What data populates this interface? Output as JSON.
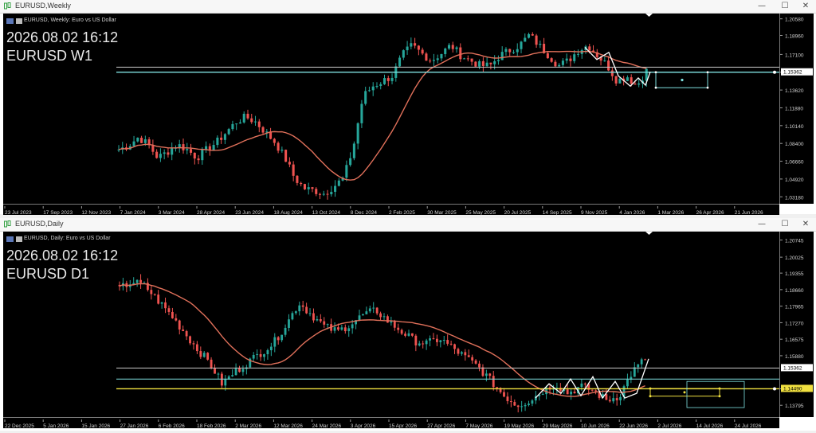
{
  "windows": [
    {
      "title": "EURUSD,Weekly",
      "symbol_label": "EURUSD, Weekly:  Euro vs US Dollar",
      "overlay_date": "2026.08.02 16:12",
      "overlay_symbol": "EURUSD W1",
      "price_tag": "1.15362",
      "buttons": {
        "minimize": "—",
        "maximize": "☐",
        "close": "✕"
      }
    },
    {
      "title": "EURUSD,Daily",
      "symbol_label": "EURUSD, Daily:  Euro vs US Dollar",
      "overlay_date": "2026.08.02 16:12",
      "overlay_symbol": "EURUSD D1",
      "price_tag": "1.15362",
      "price_tag_2": "1.14490",
      "buttons": {
        "minimize": "—",
        "maximize": "☐",
        "close": "✕"
      }
    }
  ],
  "colors": {
    "bull": "#26a69a",
    "bear": "#ef5350",
    "ma": "#e0705a",
    "hline_cyan": "#7fe0e0",
    "hline_gray": "#c8c8c8",
    "hline_yellow": "#f0e040",
    "zigzag": "#ffffff"
  },
  "chart_data": [
    {
      "type": "candlestick",
      "timeframe": "W1",
      "ylim": [
        1.025,
        1.211
      ],
      "y_ticks": [
        "1.20580",
        "1.18960",
        "1.17100",
        "1.15365",
        "1.13620",
        "1.11880",
        "1.10140",
        "1.08400",
        "1.06660",
        "1.04920",
        "1.03180"
      ],
      "x_ticks": [
        "23 Jul 2023",
        "17 Sep 2023",
        "12 Nov 2023",
        "7 Jan 2024",
        "3 Mar 2024",
        "28 Apr 2024",
        "23 Jun 2024",
        "18 Aug 2024",
        "13 Oct 2024",
        "8 Dec 2024",
        "2 Feb 2025",
        "30 Mar 2025",
        "25 May 2025",
        "20 Jul 2025",
        "14 Sep 2025",
        "9 Nov 2025",
        "4 Jan 2026",
        "1 Mar 2026",
        "26 Apr 2026",
        "21 Jun 2026"
      ],
      "ohlc_anchor_closes": [
        1.078,
        1.082,
        1.09,
        1.083,
        1.07,
        1.076,
        1.083,
        1.078,
        1.07,
        1.078,
        1.085,
        1.095,
        1.105,
        1.11,
        1.105,
        1.095,
        1.085,
        1.07,
        1.05,
        1.04,
        1.038,
        1.035,
        1.042,
        1.05,
        1.08,
        1.13,
        1.14,
        1.145,
        1.15,
        1.17,
        1.18,
        1.172,
        1.165,
        1.172,
        1.18,
        1.17,
        1.165,
        1.16,
        1.16,
        1.17,
        1.175,
        1.18,
        1.19,
        1.18,
        1.17,
        1.16,
        1.165,
        1.175,
        1.18,
        1.17,
        1.16,
        1.145,
        1.15,
        1.14,
        1.155
      ],
      "series": [
        {
          "name": "MA"
        }
      ],
      "hlines": [
        1.1586,
        1.15362
      ],
      "box": {
        "top": 1.1536,
        "bottom": 1.1385,
        "mid": 1.146
      }
    },
    {
      "type": "candlestick",
      "timeframe": "D1",
      "ylim": [
        1.133,
        1.211
      ],
      "y_ticks": [
        "1.20745",
        "1.20025",
        "1.19355",
        "1.18660",
        "1.17965",
        "1.17270",
        "1.16575",
        "1.15880",
        "1.14490",
        "1.13795"
      ],
      "x_ticks": [
        "22 Dec 2025",
        "5 Jan 2026",
        "15 Jan 2026",
        "27 Jan 2026",
        "6 Feb 2026",
        "18 Feb 2026",
        "2 Mar 2026",
        "12 Mar 2026",
        "24 Mar 2026",
        "3 Apr 2026",
        "15 Apr 2026",
        "27 Apr 2026",
        "7 May 2026",
        "19 May 2026",
        "29 May 2026",
        "10 Jun 2026",
        "22 Jun 2026",
        "2 Jul 2026",
        "14 Jul 2026",
        "24 Jul 2026"
      ],
      "ohlc_anchor_closes": [
        1.187,
        1.19,
        1.188,
        1.182,
        1.176,
        1.169,
        1.162,
        1.156,
        1.147,
        1.152,
        1.156,
        1.16,
        1.164,
        1.172,
        1.181,
        1.176,
        1.171,
        1.169,
        1.172,
        1.176,
        1.178,
        1.173,
        1.169,
        1.165,
        1.164,
        1.166,
        1.162,
        1.158,
        1.154,
        1.148,
        1.142,
        1.138,
        1.14,
        1.144,
        1.147,
        1.143,
        1.146,
        1.144,
        1.14,
        1.142,
        1.152,
        1.1575
      ],
      "series": [
        {
          "name": "MA"
        }
      ],
      "hlines": [
        1.15365,
        1.149,
        1.1449
      ],
      "box": {
        "top": 1.15,
        "bottom": 1.138
      }
    }
  ]
}
